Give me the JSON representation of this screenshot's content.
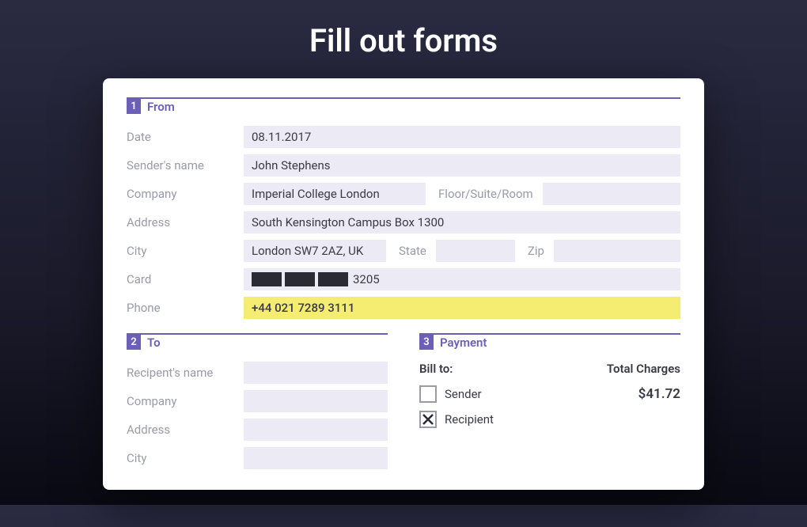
{
  "page_title": "Fill out forms",
  "sections": {
    "from": {
      "number": "1",
      "title": "From"
    },
    "to": {
      "number": "2",
      "title": "To"
    },
    "payment": {
      "number": "3",
      "title": "Payment"
    }
  },
  "from": {
    "labels": {
      "date": "Date",
      "sender_name": "Sender's name",
      "company": "Company",
      "floor": "Floor/Suite/Room",
      "address": "Address",
      "city": "City",
      "state": "State",
      "zip": "Zip",
      "card": "Card",
      "phone": "Phone"
    },
    "values": {
      "date": "08.11.2017",
      "sender_name": "John Stephens",
      "company": "Imperial College London",
      "floor": "",
      "address": "South Kensington Campus Box 1300",
      "city": "London SW7 2AZ, UK",
      "state": "",
      "zip": "",
      "card_last": "3205",
      "phone": "+44 021 7289 3111"
    }
  },
  "to": {
    "labels": {
      "recipient_name": "Recipent's name",
      "company": "Company",
      "address": "Address",
      "city": "City"
    },
    "values": {
      "recipient_name": "",
      "company": "",
      "address": "",
      "city": ""
    }
  },
  "payment": {
    "bill_to_label": "Bill to:",
    "total_label": "Total  Charges",
    "options": {
      "sender": "Sender",
      "recipient": "Recipient"
    },
    "selected": "recipient",
    "total": "$41.72"
  }
}
